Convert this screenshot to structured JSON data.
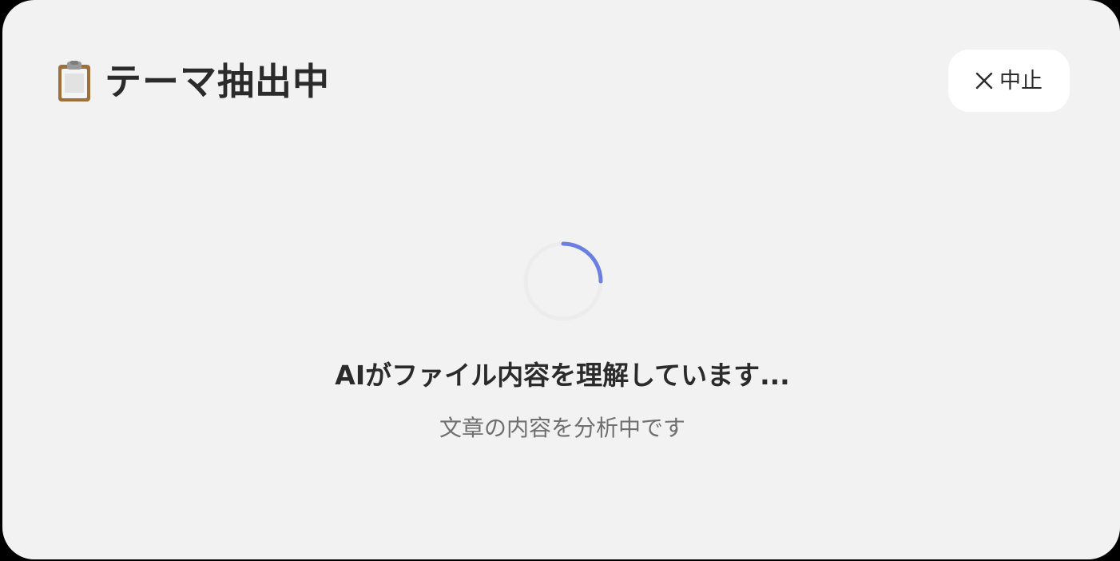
{
  "dialog": {
    "title": "テーマ抽出中",
    "title_icon": "clipboard-icon",
    "cancel_label": "中止",
    "cancel_icon": "close-icon"
  },
  "loading": {
    "spinner_icon": "loading-spinner",
    "accent_color": "#6b7fe0",
    "message": "AIがファイル内容を理解しています...",
    "submessage": "文章の内容を分析中です"
  }
}
